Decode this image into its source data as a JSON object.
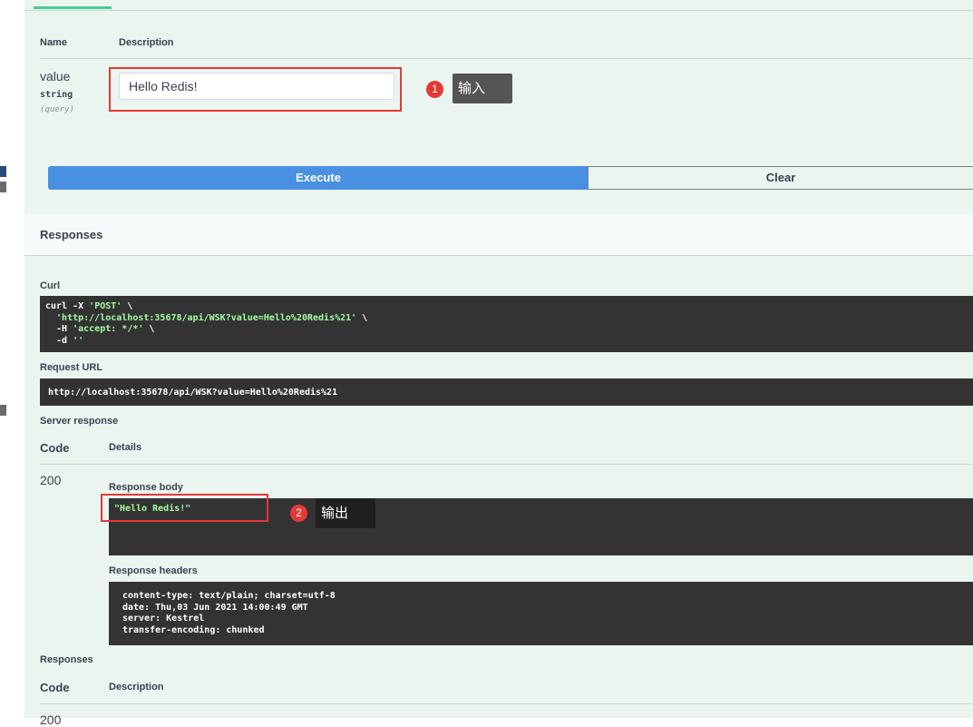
{
  "params_table": {
    "header_name": "Name",
    "header_description": "Description",
    "param": {
      "name": "value",
      "type": "string",
      "in": "(query)",
      "input_value": "Hello Redis!"
    }
  },
  "annotations": {
    "input": {
      "number": "1",
      "label": "输入"
    },
    "output": {
      "number": "2",
      "label": "输出"
    }
  },
  "buttons": {
    "execute": "Execute",
    "clear": "Clear"
  },
  "responses_title": "Responses",
  "curl": {
    "label": "Curl",
    "line1_cmd": "curl -X ",
    "line1_method": "'POST'",
    "line1_tail": " \\",
    "line2_url": "  'http://localhost:35678/api/WSK?value=Hello%20Redis%21'",
    "line2_tail": " \\",
    "line3_flag": "  -H ",
    "line3_header": "'accept: */*'",
    "line3_tail": " \\",
    "line4_flag": "  -d ",
    "line4_data": "''"
  },
  "request_url": {
    "label": "Request URL",
    "value": "http://localhost:35678/api/WSK?value=Hello%20Redis%21"
  },
  "server_response": {
    "label": "Server response",
    "col_code": "Code",
    "col_details": "Details",
    "status_code": "200",
    "body_label": "Response body",
    "body": "\"Hello Redis!\"",
    "headers_label": "Response headers",
    "headers": [
      "content-type: text/plain; charset=utf-8",
      "date: Thu,03 Jun 2021 14:00:49 GMT",
      "server: Kestrel",
      "transfer-encoding: chunked"
    ]
  },
  "responses_section": {
    "title": "Responses",
    "col_code": "Code",
    "col_description": "Description",
    "first_code": "200"
  },
  "colors": {
    "execute": "#4990e2",
    "panel": "#eaf5ef",
    "code_bg": "#333333",
    "highlight": "#e53935"
  }
}
